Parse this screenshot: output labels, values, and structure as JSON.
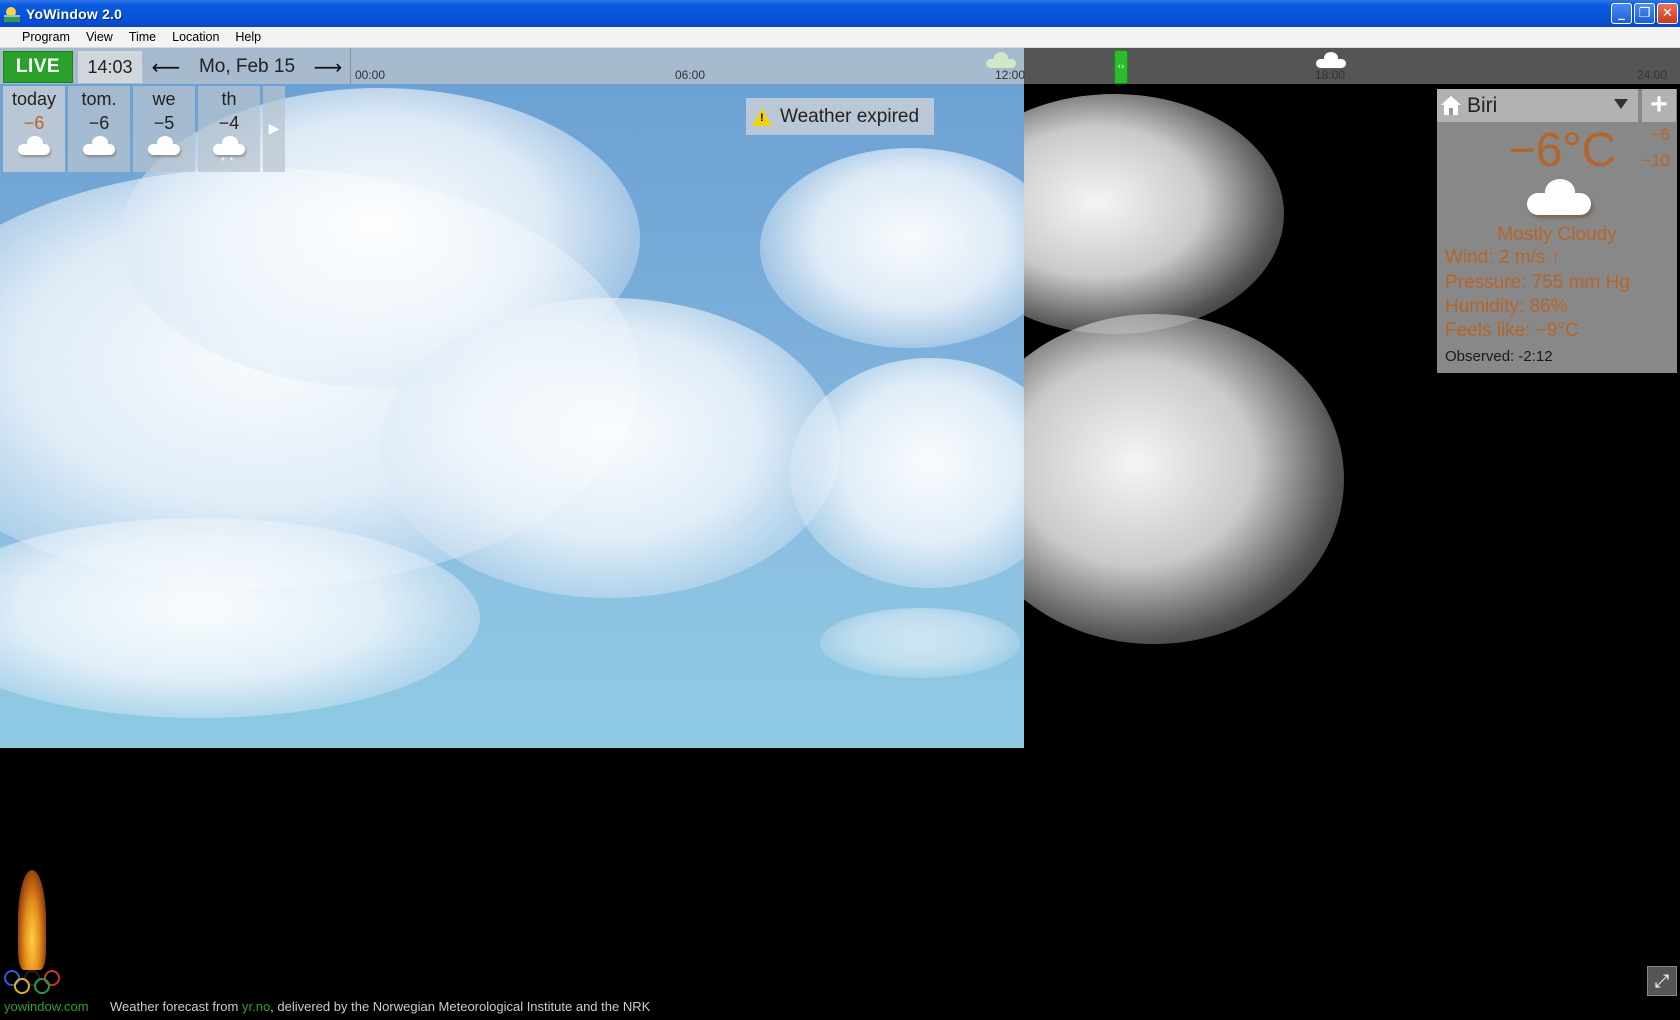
{
  "window": {
    "title": "YoWindow 2.0"
  },
  "menu": [
    "Program",
    "View",
    "Time",
    "Location",
    "Help"
  ],
  "timeline": {
    "live_label": "LIVE",
    "time": "14:03",
    "date": "Mo, Feb 15",
    "hours": [
      "00:00",
      "06:00",
      "12:00",
      "18:00",
      "24:00"
    ]
  },
  "forecast": [
    {
      "day": "today",
      "temp": "−6",
      "icon": "cloud-icon"
    },
    {
      "day": "tom.",
      "temp": "−6",
      "icon": "cloud-icon"
    },
    {
      "day": "we",
      "temp": "−5",
      "icon": "cloud-icon"
    },
    {
      "day": "th",
      "temp": "−4",
      "icon": "snow-cloud-icon",
      "snow": "* *"
    }
  ],
  "notice": {
    "text": "Weather expired"
  },
  "location": {
    "name": "Biri",
    "temp": "−6°C",
    "hi": "−6",
    "lo": "−10",
    "condition": "Mostly Cloudy",
    "wind": "Wind:  2 m/s ↑",
    "pressure": "Pressure:  755 mm Hg",
    "humidity": "Humidity:  86%",
    "feels_like": "Feels like:  −9°C",
    "observed": "Observed:  -2:12"
  },
  "footer": {
    "site": "yowindow.com",
    "credit_prefix": "Weather forecast from ",
    "source": "yr.no",
    "credit_suffix": ", delivered by the Norwegian Meteorological Institute and the NRK"
  },
  "colors": {
    "accent_green": "#2aa12a",
    "temp_orange": "#b5652a"
  }
}
